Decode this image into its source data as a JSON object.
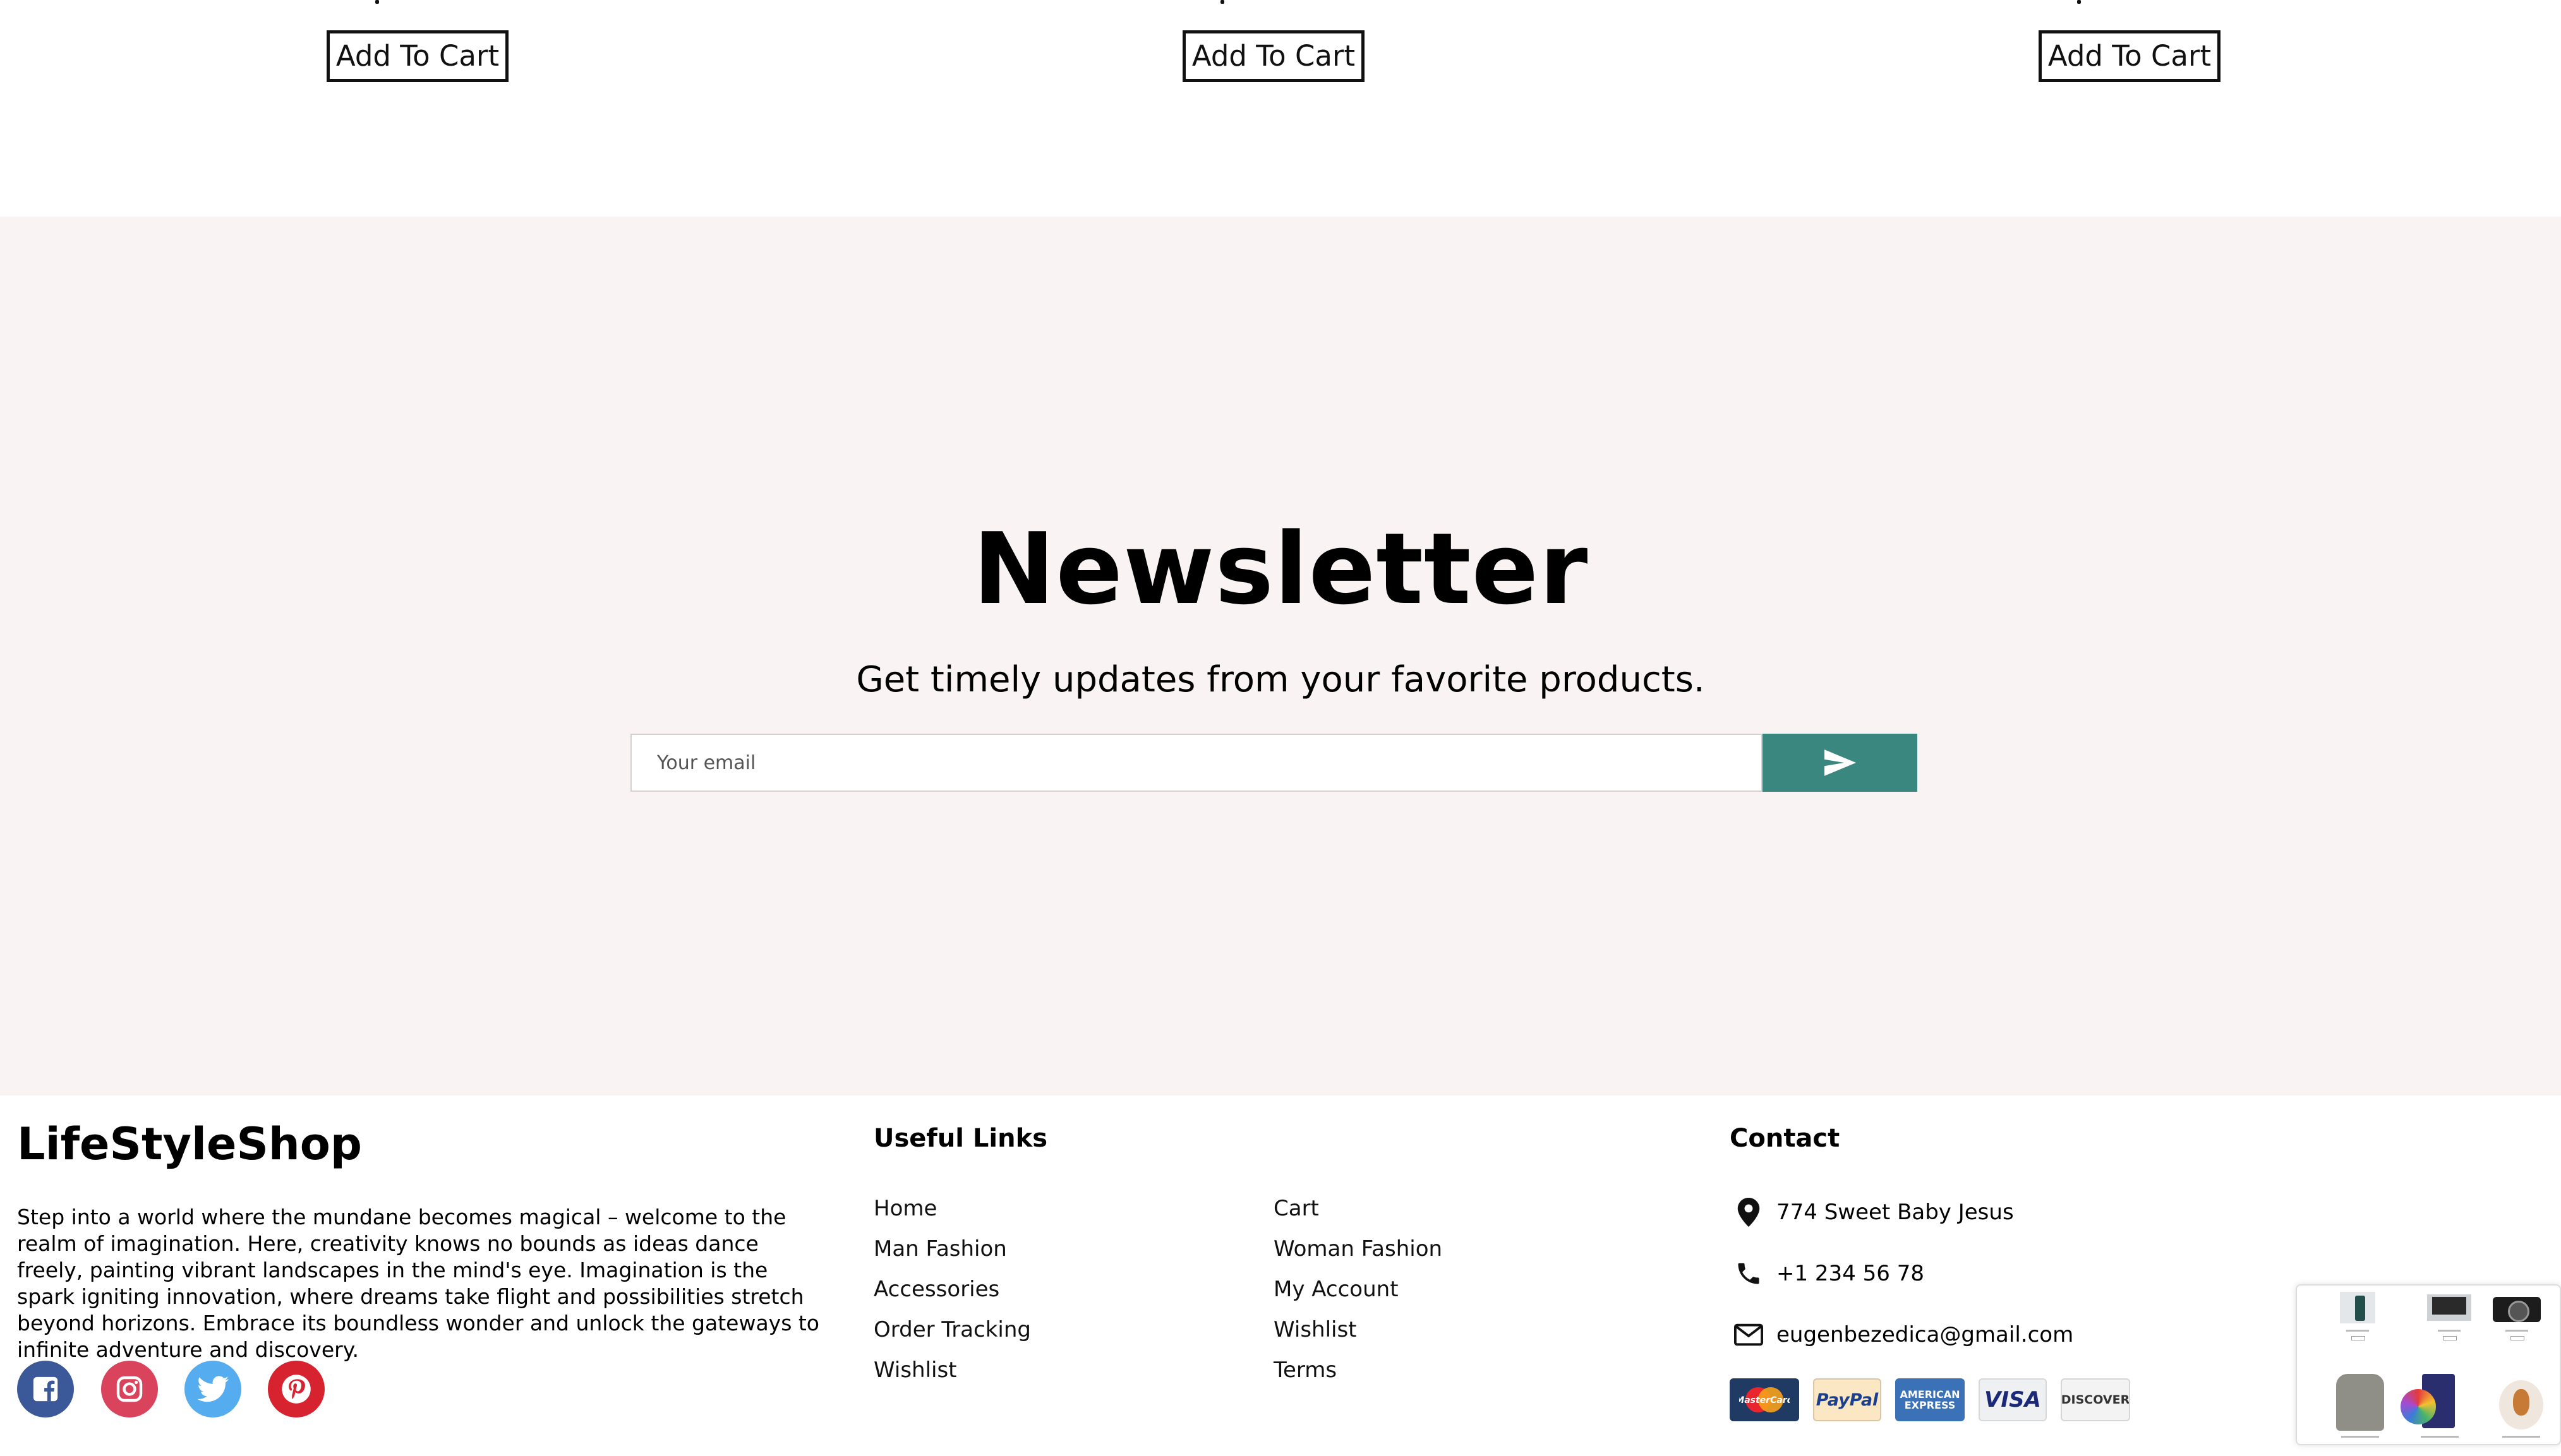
{
  "products": {
    "add_to_cart_labels": [
      "Add To Cart",
      "Add To Cart",
      "Add To Cart"
    ]
  },
  "newsletter": {
    "title": "Newsletter",
    "subtitle": "Get timely updates from your favorite products.",
    "email_placeholder": "Your email",
    "submit_icon": "send-icon"
  },
  "footer": {
    "brand": "LifeStyleShop",
    "about": "Step into a world where the mundane becomes magical – welcome to the realm of imagination. Here, creativity knows no bounds as ideas dance freely, painting vibrant landscapes in the mind's eye. Imagination is the spark igniting innovation, where dreams take flight and possibilities stretch beyond horizons. Embrace its boundless wonder and unlock the gateways to infinite adventure and discovery.",
    "social": [
      {
        "icon": "facebook-icon",
        "color": "#3b5998"
      },
      {
        "icon": "instagram-icon",
        "color": "#d9435b"
      },
      {
        "icon": "twitter-icon",
        "color": "#55acee"
      },
      {
        "icon": "pinterest-icon",
        "color": "#d7232f"
      }
    ],
    "useful_links_title": "Useful Links",
    "links_col1": [
      "Home",
      "Man Fashion",
      "Accessories",
      "Order Tracking",
      "Wishlist"
    ],
    "links_col2": [
      "Cart",
      "Woman Fashion",
      "My Account",
      "Wishlist",
      "Terms"
    ],
    "contact_title": "Contact",
    "contact": {
      "address": "774 Sweet Baby Jesus",
      "phone": "+1 234 56 78",
      "email": "eugenbezedica@gmail.com"
    },
    "payment_methods": [
      "MasterCard",
      "PayPal",
      "AMERICAN EXPRESS",
      "VISA",
      "DISCOVER"
    ]
  },
  "colors": {
    "newsletter_bg": "#f9f4f3",
    "accent": "#3a8780"
  }
}
